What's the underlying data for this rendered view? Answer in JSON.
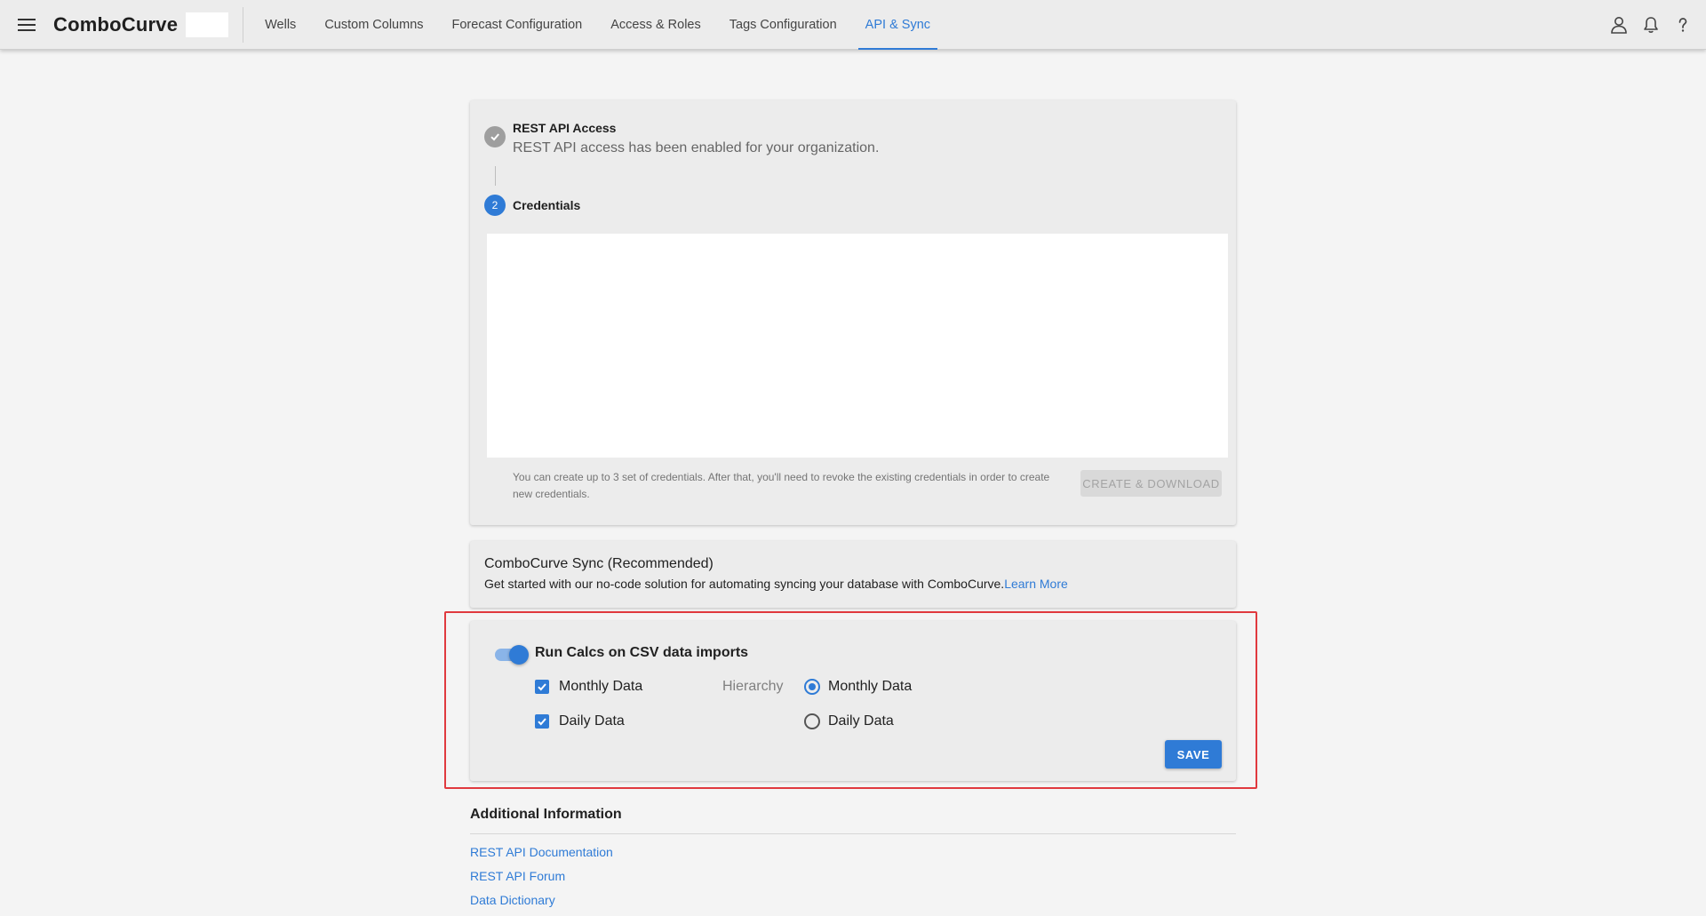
{
  "app": {
    "brand": "ComboCurve"
  },
  "nav": {
    "tabs": [
      {
        "label": "Wells"
      },
      {
        "label": "Custom Columns"
      },
      {
        "label": "Forecast Configuration"
      },
      {
        "label": "Access & Roles"
      },
      {
        "label": "Tags Configuration"
      },
      {
        "label": "API & Sync",
        "active": true
      }
    ]
  },
  "icons": {
    "menu": "hamburger-menu-icon",
    "user": "user-icon",
    "bell": "bell-icon",
    "help": "help-icon",
    "check": "check-icon"
  },
  "colors": {
    "accent": "#2f7bd6",
    "highlight": "#e0393e"
  },
  "api_card": {
    "step1": {
      "title": "REST API Access",
      "subtitle": "REST API access has been enabled for your organization."
    },
    "step2": {
      "number": "2",
      "title": "Credentials"
    },
    "note": "You can create up to 3 set of credentials. After that, you'll need to revoke the existing credentials in order to create new credentials.",
    "create_button": "CREATE & DOWNLOAD"
  },
  "sync_card": {
    "title": "ComboCurve Sync (Recommended)",
    "description": "Get started with our no-code solution for automating syncing your database with ComboCurve.",
    "learn_more": "Learn More"
  },
  "calcs_card": {
    "toggle_label": "Run Calcs on CSV data imports",
    "toggle_on": true,
    "checkboxes": [
      {
        "label": "Monthly Data",
        "checked": true
      },
      {
        "label": "Daily Data",
        "checked": true
      }
    ],
    "hierarchy_label": "Hierarchy",
    "radios": [
      {
        "label": "Monthly Data",
        "selected": true
      },
      {
        "label": "Daily Data",
        "selected": false
      }
    ],
    "save_button": "SAVE"
  },
  "additional": {
    "title": "Additional Information",
    "links": [
      {
        "label": "REST API Documentation"
      },
      {
        "label": "REST API Forum"
      },
      {
        "label": "Data Dictionary"
      }
    ]
  }
}
